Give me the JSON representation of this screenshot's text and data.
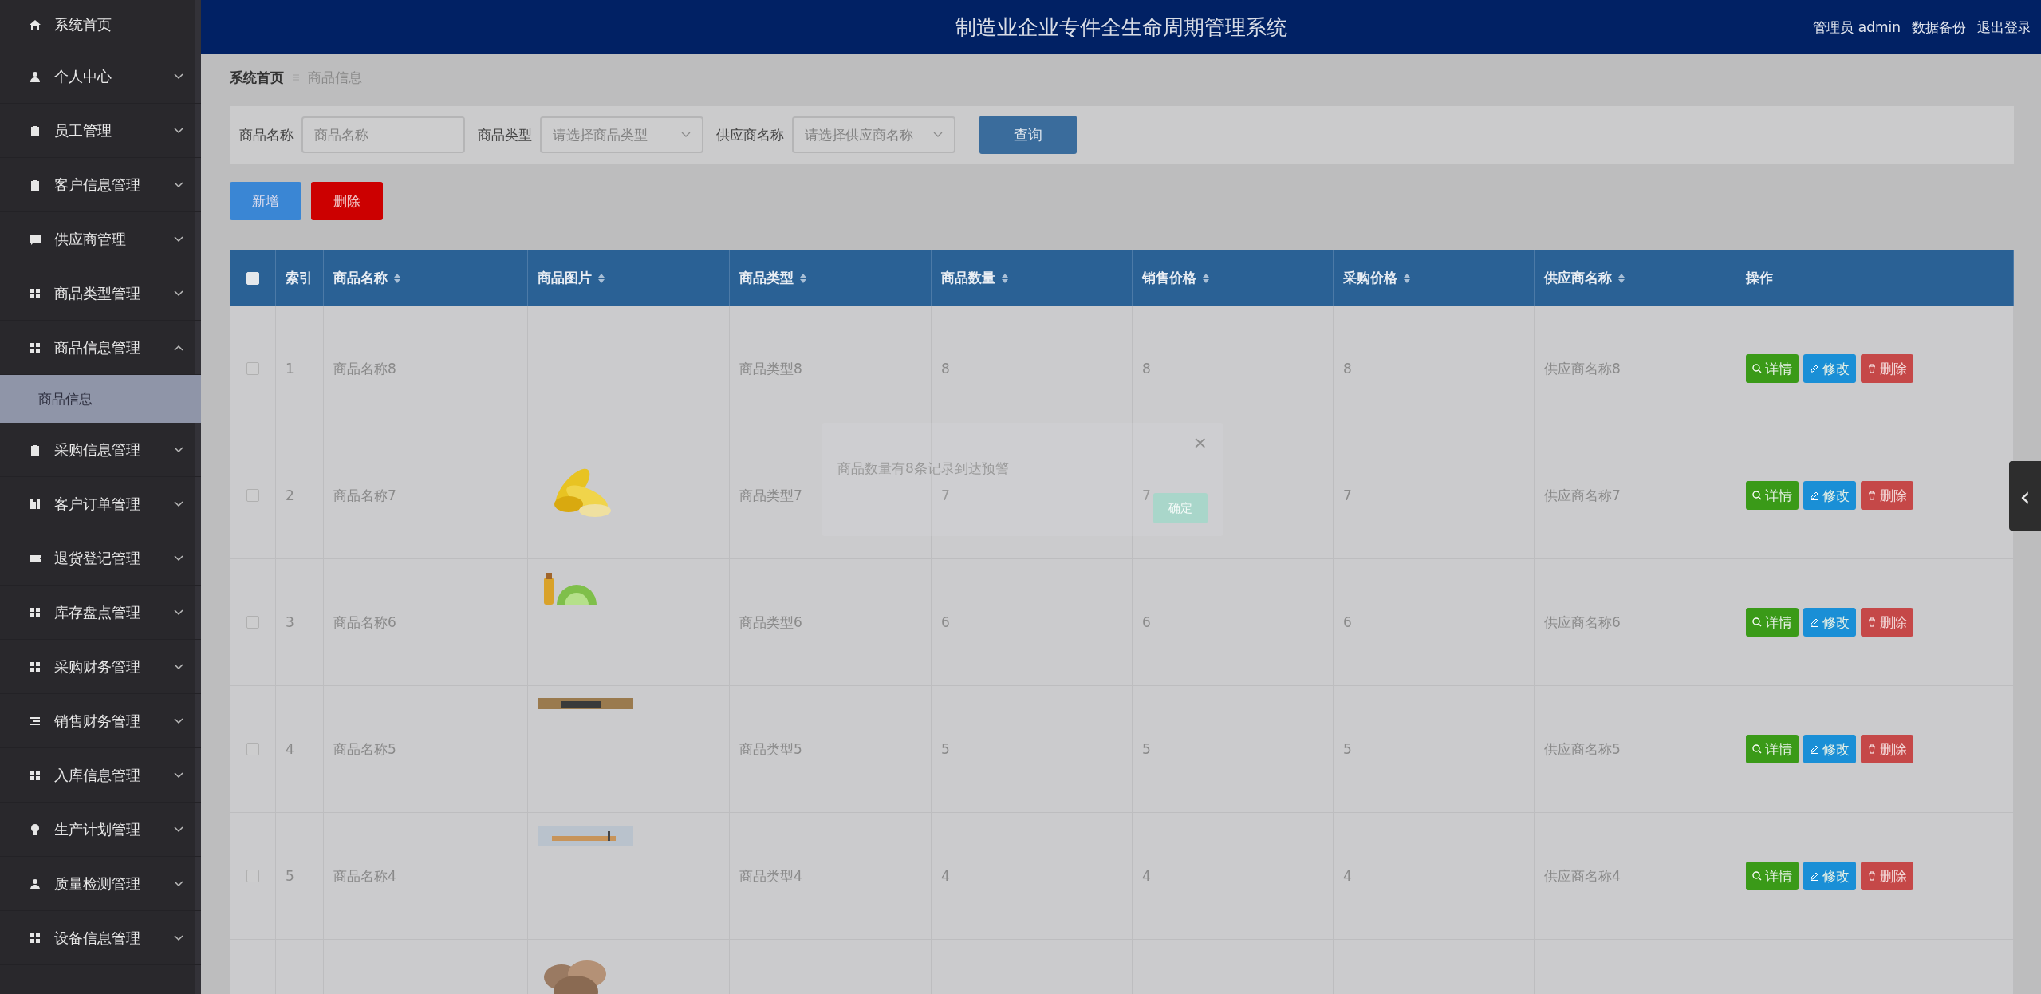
{
  "sidebar": {
    "items": [
      {
        "label": "系统首页",
        "kind": "link"
      },
      {
        "label": "个人中心",
        "kind": "menu",
        "expanded": false
      },
      {
        "label": "员工管理",
        "kind": "menu",
        "expanded": false
      },
      {
        "label": "客户信息管理",
        "kind": "menu",
        "expanded": false
      },
      {
        "label": "供应商管理",
        "kind": "menu",
        "expanded": false
      },
      {
        "label": "商品类型管理",
        "kind": "menu",
        "expanded": false
      },
      {
        "label": "商品信息管理",
        "kind": "menu",
        "expanded": true,
        "children": [
          {
            "label": "商品信息",
            "selected": true
          }
        ]
      },
      {
        "label": "采购信息管理",
        "kind": "menu",
        "expanded": false
      },
      {
        "label": "客户订单管理",
        "kind": "menu",
        "expanded": false
      },
      {
        "label": "退货登记管理",
        "kind": "menu",
        "expanded": false
      },
      {
        "label": "库存盘点管理",
        "kind": "menu",
        "expanded": false
      },
      {
        "label": "采购财务管理",
        "kind": "menu",
        "expanded": false
      },
      {
        "label": "销售财务管理",
        "kind": "menu",
        "expanded": false
      },
      {
        "label": "入库信息管理",
        "kind": "menu",
        "expanded": false
      },
      {
        "label": "生产计划管理",
        "kind": "menu",
        "expanded": false
      },
      {
        "label": "质量检测管理",
        "kind": "menu",
        "expanded": false
      },
      {
        "label": "设备信息管理",
        "kind": "menu",
        "expanded": false
      }
    ]
  },
  "header": {
    "title": "制造业企业专件全生命周期管理系统",
    "links": [
      "管理员 admin",
      "数据备份",
      "退出登录"
    ]
  },
  "breadcrumb": {
    "home": "系统首页",
    "current": "商品信息"
  },
  "search": {
    "fields": [
      {
        "label": "商品名称",
        "kind": "input",
        "placeholder": "商品名称"
      },
      {
        "label": "商品类型",
        "kind": "select",
        "placeholder": "请选择商品类型"
      },
      {
        "label": "供应商名称",
        "kind": "select",
        "placeholder": "请选择供应商名称"
      }
    ],
    "button": "查询"
  },
  "actions": {
    "add": "新增",
    "delete": "删除"
  },
  "table": {
    "select_all_checked": false,
    "columns": [
      {
        "label": "索引",
        "sortable": false
      },
      {
        "label": "商品名称",
        "sortable": true
      },
      {
        "label": "商品图片",
        "sortable": true
      },
      {
        "label": "商品类型",
        "sortable": true
      },
      {
        "label": "商品数量",
        "sortable": true
      },
      {
        "label": "销售价格",
        "sortable": true
      },
      {
        "label": "采购价格",
        "sortable": true
      },
      {
        "label": "供应商名称",
        "sortable": true
      },
      {
        "label": "操作",
        "sortable": false
      }
    ],
    "rows": [
      {
        "kind": "full",
        "checked": false,
        "cells": [
          "1",
          "商品名称8",
          "",
          "商品类型8",
          "8",
          "8",
          "8",
          "供应商名称8"
        ],
        "has_picture": false,
        "buttons": [
          "详情",
          "修改",
          "删除"
        ]
      },
      {
        "kind": "full",
        "checked": false,
        "cells": [
          "2",
          "商品名称7",
          "",
          "商品类型7",
          "7",
          "7",
          "7",
          "供应商名称7"
        ],
        "has_picture": true,
        "buttons": [
          "详情",
          "修改",
          "删除"
        ]
      },
      {
        "kind": "full",
        "checked": false,
        "cells": [
          "3",
          "商品名称6",
          "",
          "商品类型6",
          "6",
          "6",
          "6",
          "供应商名称6"
        ],
        "has_picture": true,
        "buttons": [
          "详情",
          "修改",
          "删除"
        ]
      },
      {
        "kind": "full",
        "checked": false,
        "cells": [
          "4",
          "商品名称5",
          "",
          "商品类型5",
          "5",
          "5",
          "5",
          "供应商名称5"
        ],
        "has_picture": true,
        "buttons": [
          "详情",
          "修改",
          "删除"
        ]
      },
      {
        "kind": "full",
        "checked": false,
        "cells": [
          "5",
          "商品名称4",
          "",
          "商品类型4",
          "4",
          "4",
          "4",
          "供应商名称4"
        ],
        "has_picture": true,
        "buttons": [
          "详情",
          "修改",
          "删除"
        ]
      },
      {
        "kind": "partial",
        "has_picture": true
      }
    ]
  },
  "dialog": {
    "message": "商品数量有8条记录到达预警",
    "close": "×",
    "confirm": "确定"
  },
  "side_tab": {
    "icon": "‹"
  }
}
